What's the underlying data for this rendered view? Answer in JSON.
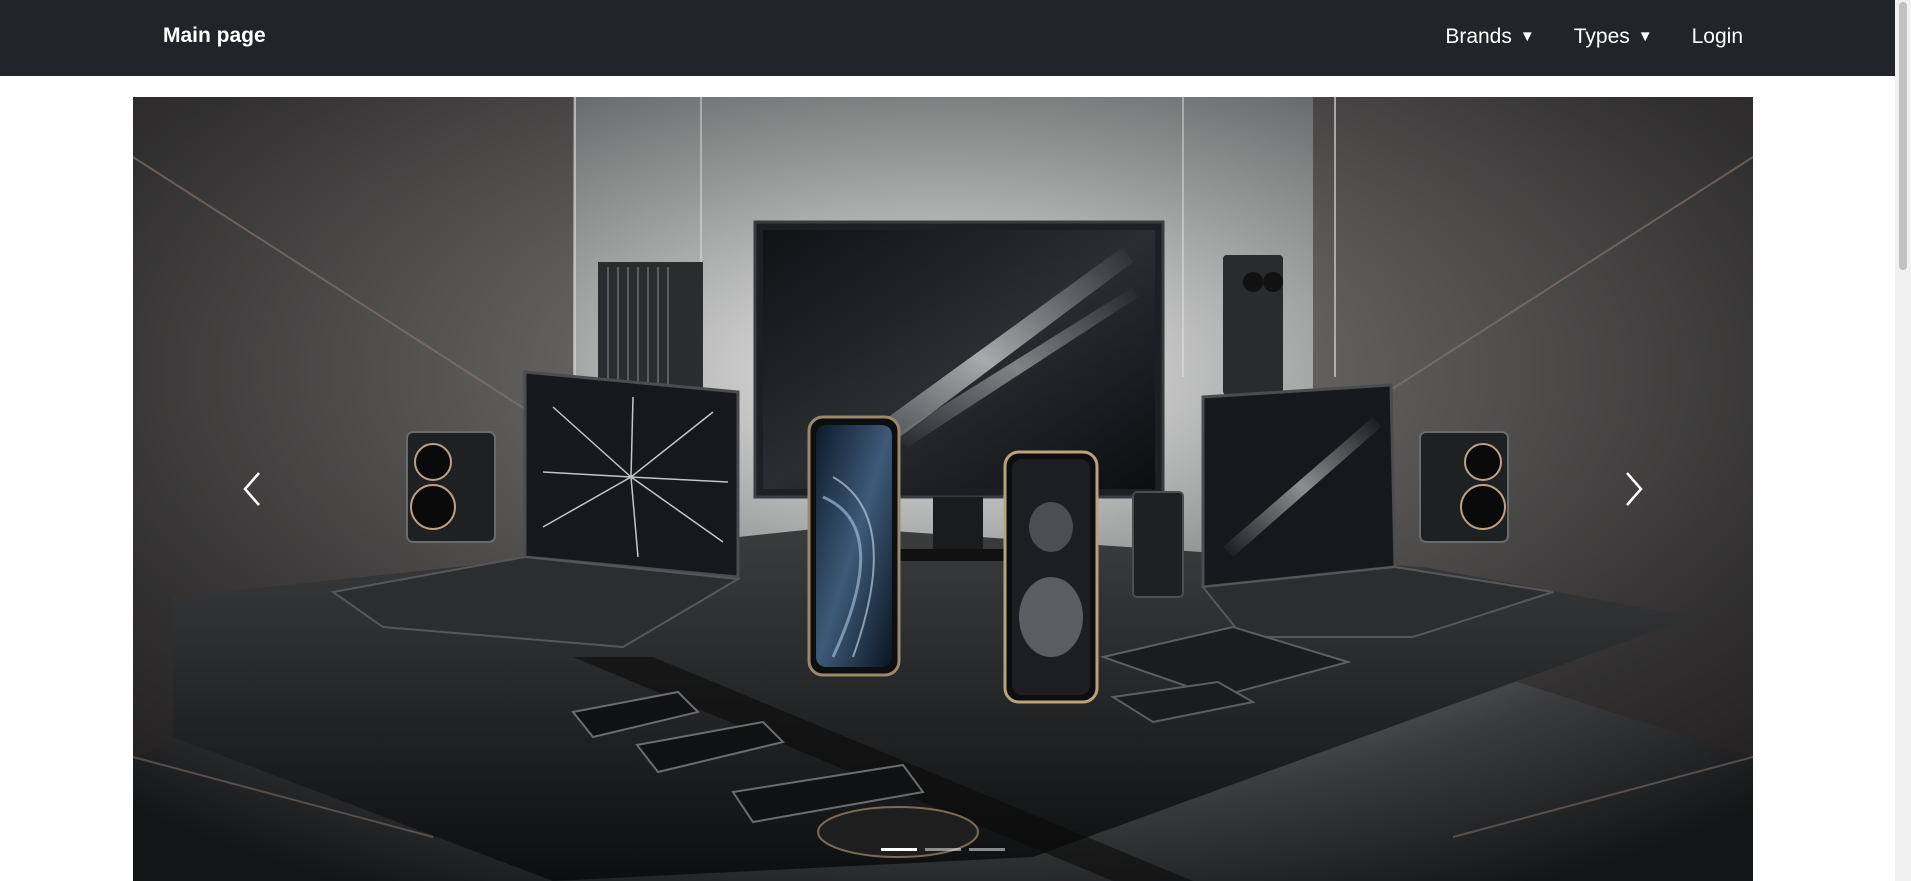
{
  "navbar": {
    "brand": "Main page",
    "brands_label": "Brands",
    "types_label": "Types",
    "login_label": "Login",
    "background": "#212529"
  },
  "carousel": {
    "slide_count": 3,
    "active_slide": 1,
    "prev_icon": "chevron-left-icon",
    "next_icon": "chevron-right-icon"
  }
}
